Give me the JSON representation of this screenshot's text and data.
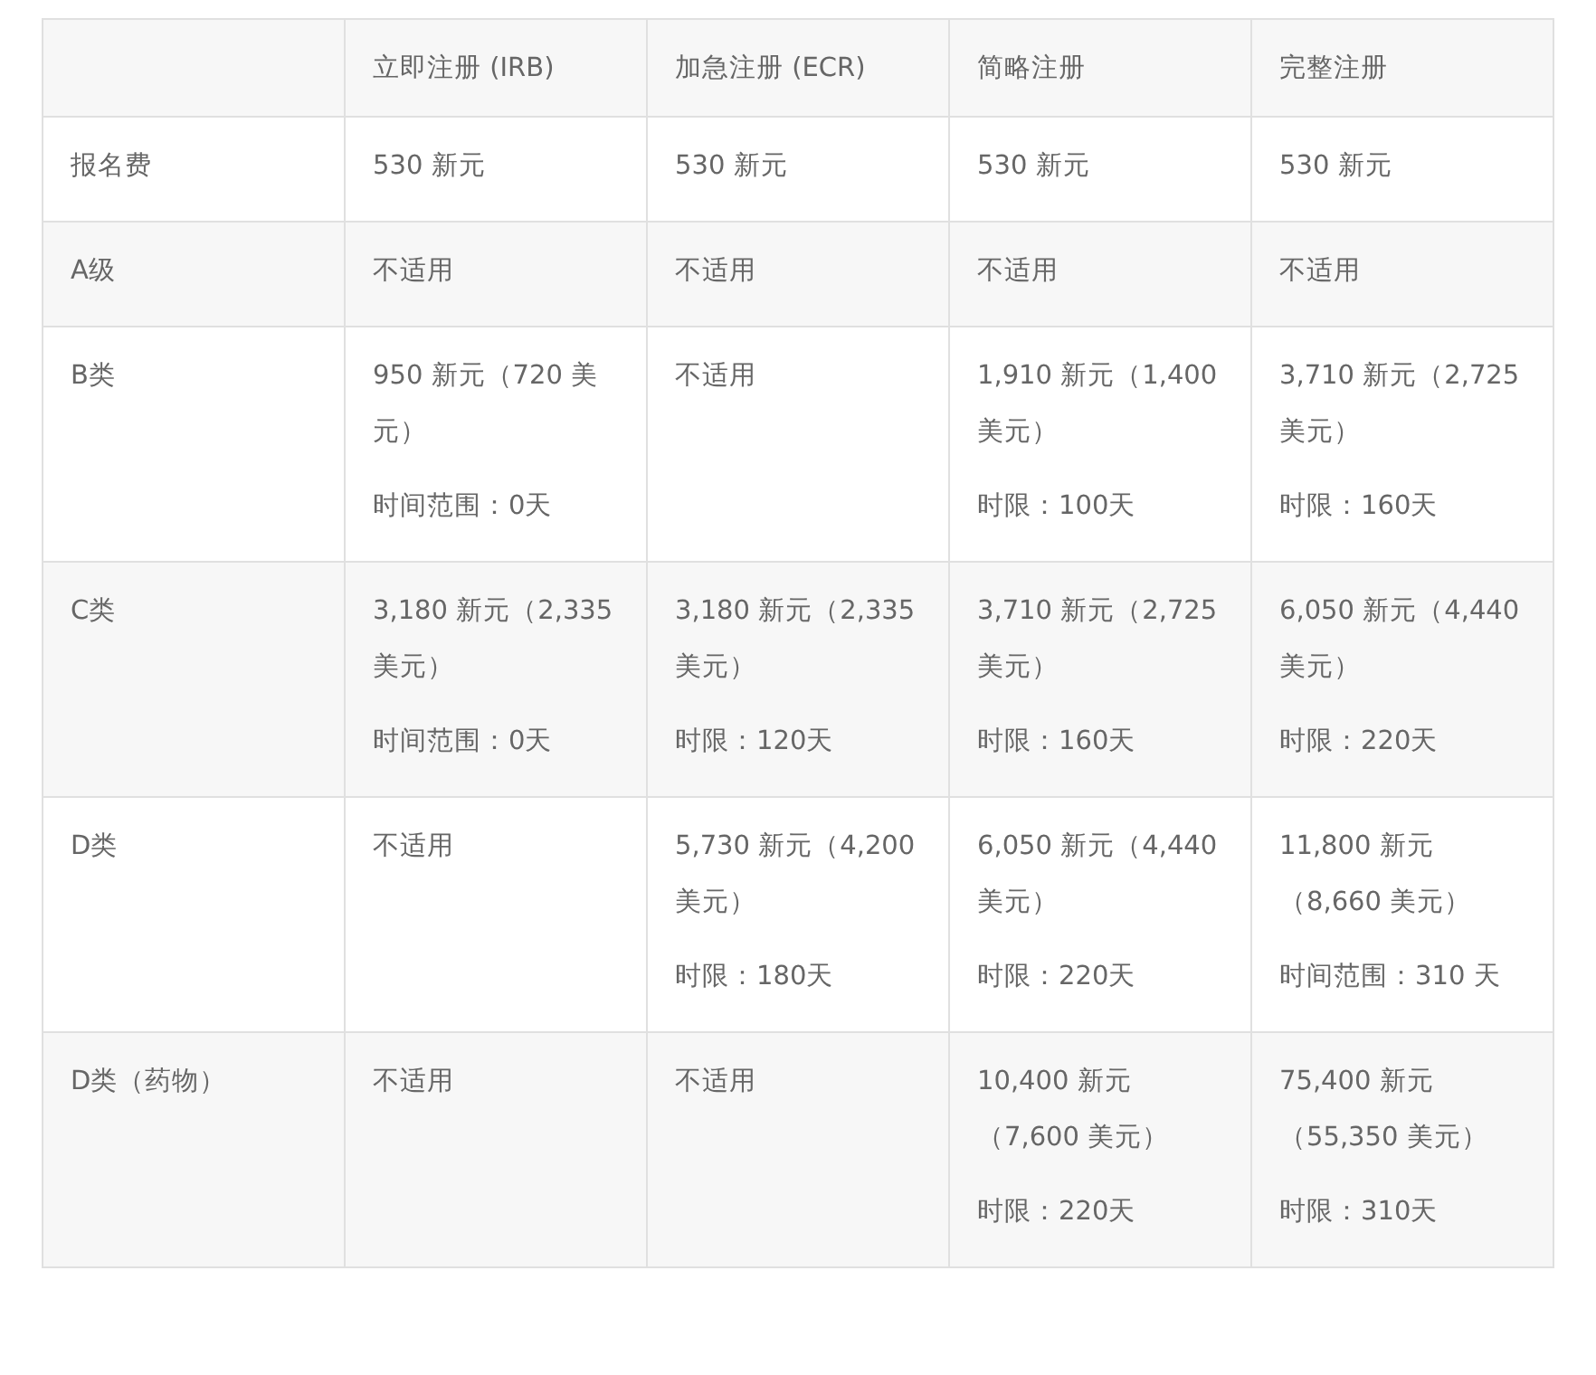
{
  "table": {
    "columns": [
      "",
      "立即注册 (IRB)",
      "加急注册 (ECR)",
      "简略注册",
      "完整注册"
    ],
    "rows": [
      {
        "cells": [
          [
            "报名费"
          ],
          [
            "530 新元"
          ],
          [
            "530 新元"
          ],
          [
            "530 新元"
          ],
          [
            "530 新元"
          ]
        ]
      },
      {
        "cells": [
          [
            "A级"
          ],
          [
            "不适用"
          ],
          [
            "不适用"
          ],
          [
            "不适用"
          ],
          [
            "不适用"
          ]
        ]
      },
      {
        "cells": [
          [
            "B类"
          ],
          [
            "950 新元（720 美元）",
            "时间范围：0天"
          ],
          [
            "不适用"
          ],
          [
            "1,910 新元（1,400 美元）",
            "时限：100天"
          ],
          [
            "3,710 新元（2,725 美元）",
            "时限：160天"
          ]
        ]
      },
      {
        "cells": [
          [
            "C类"
          ],
          [
            "3,180 新元（2,335 美元）",
            "时间范围：0天"
          ],
          [
            "3,180 新元（2,335 美元）",
            "时限：120天"
          ],
          [
            "3,710 新元（2,725 美元）",
            "时限：160天"
          ],
          [
            "6,050 新元（4,440 美元）",
            "时限：220天"
          ]
        ]
      },
      {
        "cells": [
          [
            "D类"
          ],
          [
            "不适用"
          ],
          [
            "5,730 新元（4,200 美元）",
            "时限：180天"
          ],
          [
            "6,050 新元（4,440 美元）",
            "时限：220天"
          ],
          [
            "11,800 新元（8,660 美元）",
            "时间范围：310 天"
          ]
        ]
      },
      {
        "cells": [
          [
            "D类（药物）"
          ],
          [
            "不适用"
          ],
          [
            "不适用"
          ],
          [
            "10,400 新元（7,600 美元）",
            "时限：220天"
          ],
          [
            "75,400 新元（55,350 美元）",
            "时限：310天"
          ]
        ]
      }
    ]
  }
}
